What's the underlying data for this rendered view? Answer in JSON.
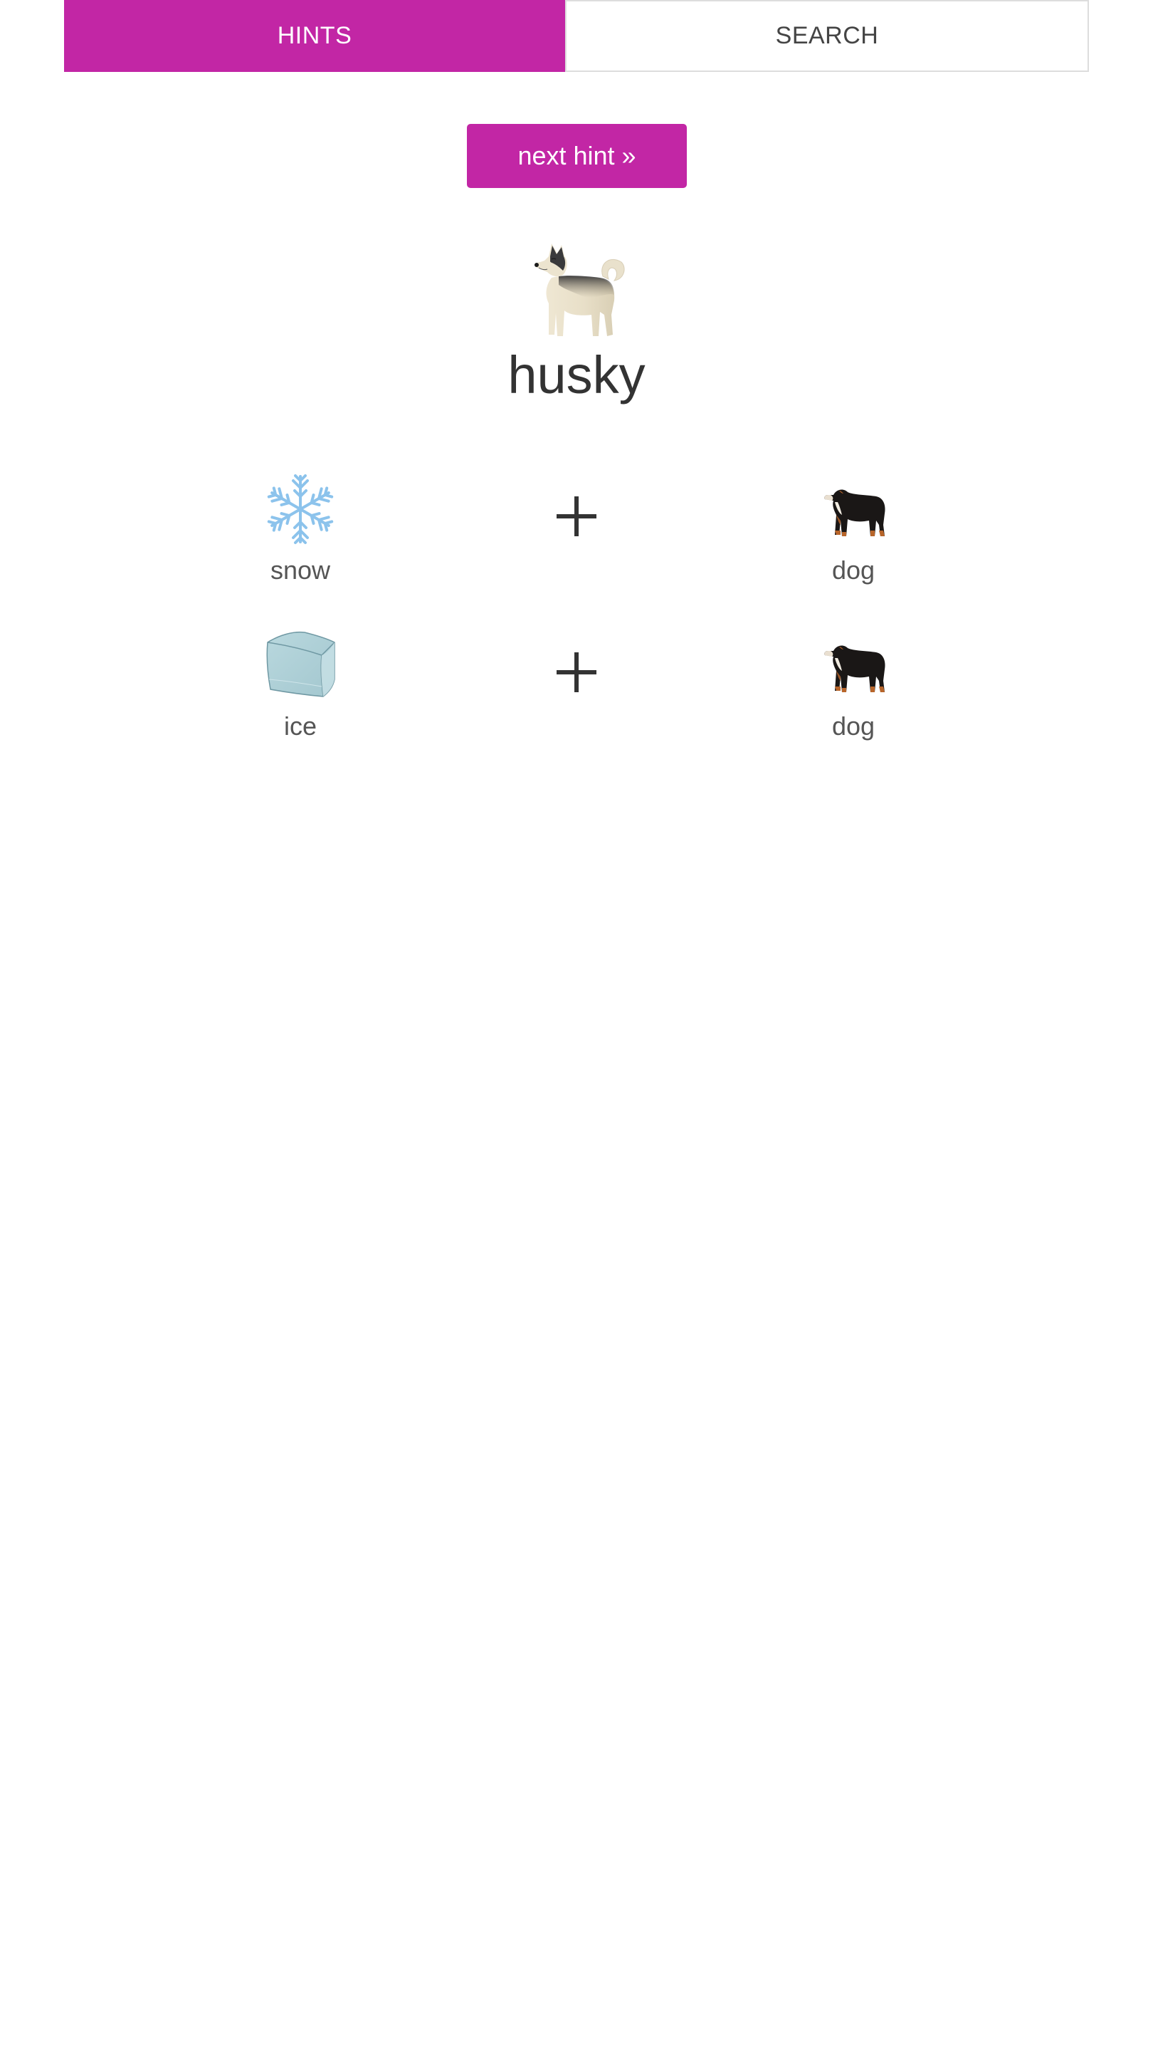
{
  "tabs": [
    {
      "label": "HINTS",
      "active": true
    },
    {
      "label": "SEARCH",
      "active": false
    }
  ],
  "next_hint_button": {
    "label": "next hint »"
  },
  "result": {
    "label": "husky",
    "icon": "husky-dog-icon"
  },
  "combinations": [
    {
      "left": {
        "label": "snow",
        "icon": "snowflake-icon"
      },
      "operator": "+",
      "right": {
        "label": "dog",
        "icon": "dog-icon"
      }
    },
    {
      "left": {
        "label": "ice",
        "icon": "ice-cube-icon"
      },
      "operator": "+",
      "right": {
        "label": "dog",
        "icon": "dog-icon"
      }
    }
  ],
  "colors": {
    "accent": "#c226a5",
    "text_dark": "#333333",
    "text_label": "#555555",
    "tab_border": "#dddddd"
  }
}
